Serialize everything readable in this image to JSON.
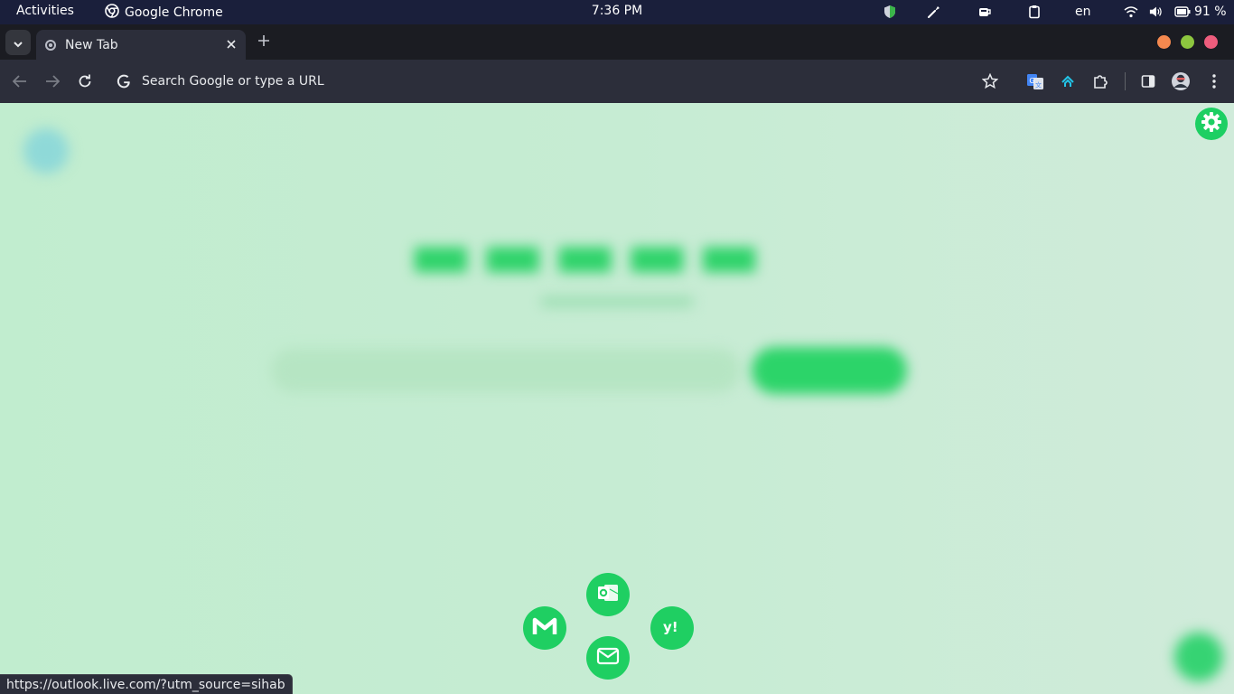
{
  "system_bar": {
    "activities": "Activities",
    "app_name": "Google Chrome",
    "clock": "7:36 PM",
    "language": "en",
    "battery_percent": "91 %",
    "tray_icons": [
      "shield-icon",
      "color-picker-icon",
      "coffee-cup-icon",
      "clipboard-icon",
      "wifi-icon",
      "volume-icon",
      "battery-icon"
    ]
  },
  "tabs": [
    {
      "title": "New Tab",
      "active": true
    }
  ],
  "window_controls": {
    "minimize_color": "#f5894f",
    "maximize_color": "#8dc63f",
    "close_color": "#ee5d7d"
  },
  "toolbar": {
    "omnibox_placeholder": "Search Google or type a URL",
    "extensions": [
      "google-translate-icon",
      "arrow-up-extension-icon",
      "puzzle-extensions-icon"
    ]
  },
  "page": {
    "accent_color": "#1fcf62",
    "background_color": "#c6ecd2",
    "quick_links": [
      {
        "name": "Outlook",
        "icon": "outlook-icon"
      },
      {
        "name": "Gmail",
        "icon": "gmail-icon"
      },
      {
        "name": "Yahoo",
        "icon": "yahoo-icon"
      },
      {
        "name": "Email",
        "icon": "envelope-icon"
      }
    ]
  },
  "status_bar": {
    "url": "https://outlook.live.com/?utm_source=sihab"
  }
}
